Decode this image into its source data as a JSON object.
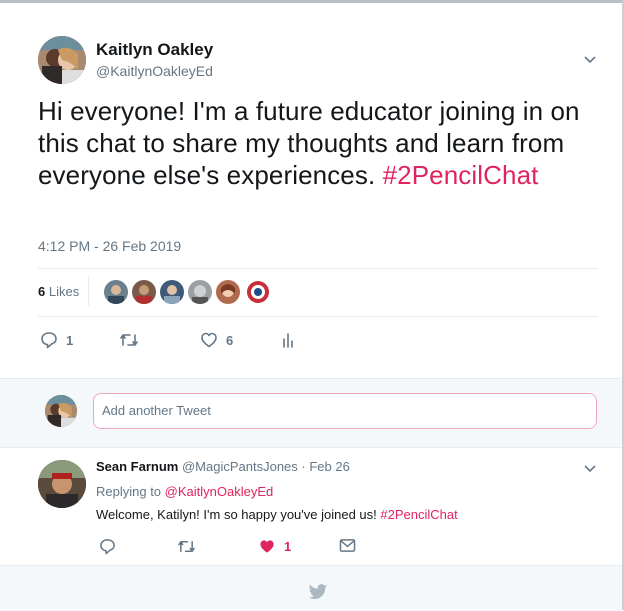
{
  "tweet": {
    "author_name": "Kaitlyn Oakley",
    "author_handle": "@KaitlynOakleyEd",
    "text": "Hi everyone! I'm a future educator joining in on this chat to share my thoughts and learn from everyone else's experiences.",
    "hashtag": "#2PencilChat",
    "timestamp": "4:12 PM - 26 Feb 2019",
    "likes_count": "6",
    "likes_label": "Likes",
    "reply_count": "1",
    "like_count_action": "6",
    "likers": [
      {
        "name": "liker-1",
        "color": "#6b7f8c"
      },
      {
        "name": "liker-2",
        "color": "#7a5a48"
      },
      {
        "name": "liker-3",
        "color": "#3e5a78"
      },
      {
        "name": "liker-4",
        "color": "#9aa0a4"
      },
      {
        "name": "liker-5",
        "color": "#b06a4e"
      },
      {
        "name": "liker-6",
        "color": "#c7303a"
      }
    ]
  },
  "reply_box": {
    "placeholder": "Add another Tweet"
  },
  "reply_tweet": {
    "author_name": "Sean Farnum",
    "author_handle": "@MagicPantsJones",
    "separator": " · ",
    "date": "Feb 26",
    "replying_prefix": "Replying to",
    "replying_to": "@KaitlynOakleyEd",
    "text": "Welcome, Katilyn! I'm so happy you've joined us!",
    "hashtag": "#2PencilChat",
    "like_count": "1"
  },
  "colors": {
    "accent": "#e0245e",
    "muted": "#657786",
    "twitter_blue_grey": "#aab8c2"
  }
}
